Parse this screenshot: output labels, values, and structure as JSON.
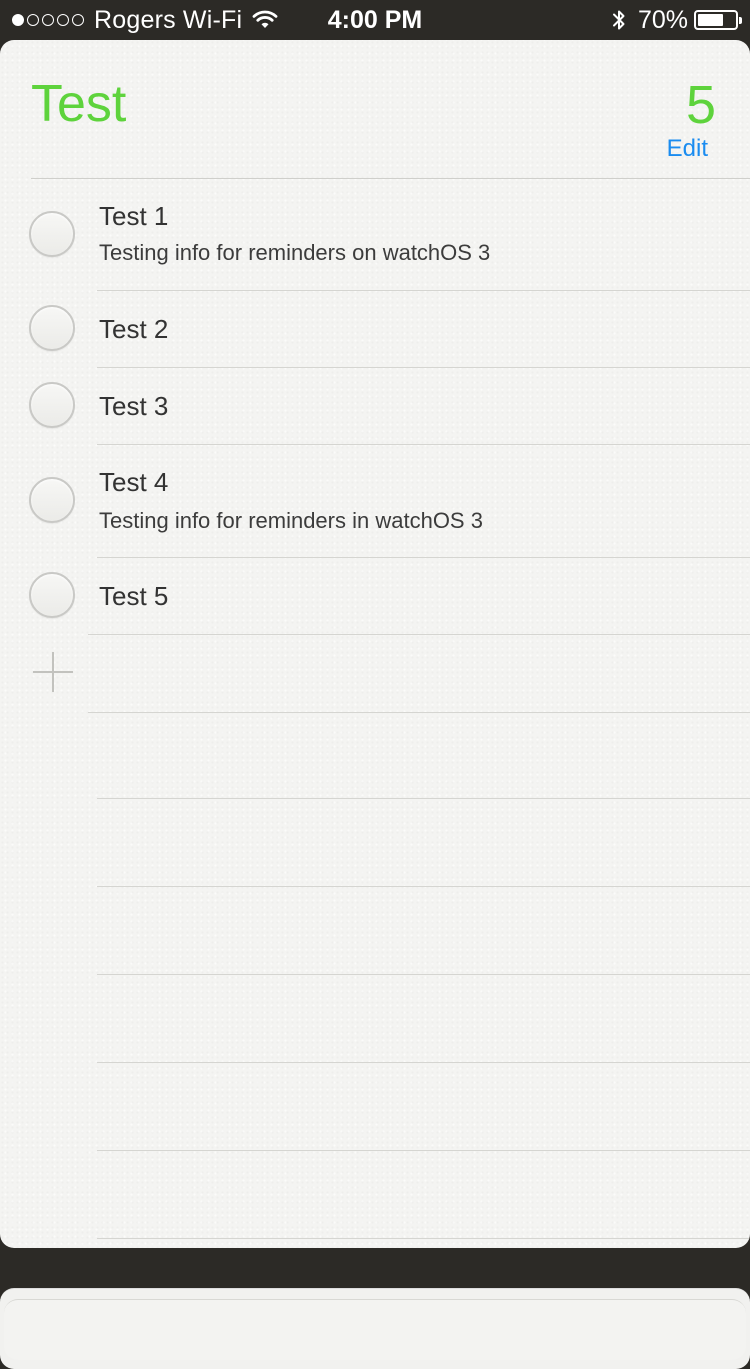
{
  "status_bar": {
    "carrier": "Rogers Wi-Fi",
    "signal_bars_filled": 1,
    "signal_bars_total": 5,
    "time": "4:00 PM",
    "battery_percent_label": "70%",
    "battery_level": 0.7,
    "icons": [
      "wifi-icon",
      "bluetooth-icon",
      "battery-icon"
    ]
  },
  "list": {
    "title": "Test",
    "count": "5",
    "edit_label": "Edit",
    "accent_color": "#5ed33c",
    "link_color": "#1a8cf0",
    "items": [
      {
        "title": "Test 1",
        "note": "Testing info for reminders on watchOS 3"
      },
      {
        "title": "Test 2",
        "note": ""
      },
      {
        "title": "Test 3",
        "note": ""
      },
      {
        "title": "Test 4",
        "note": "Testing info for reminders in watchOS 3"
      },
      {
        "title": "Test 5",
        "note": ""
      }
    ],
    "add_icon": "plus-icon"
  }
}
